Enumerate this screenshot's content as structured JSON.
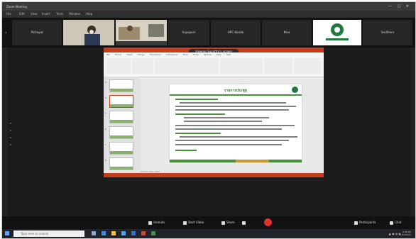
{
  "window": {
    "title": "Zoom Meeting",
    "menu": [
      "File",
      "Edit",
      "View",
      "Insert",
      "Tools",
      "Window",
      "Help"
    ]
  },
  "participants": [
    {
      "name": "Pichayut",
      "type": "name"
    },
    {
      "name": "",
      "type": "video"
    },
    {
      "name": "",
      "type": "video"
    },
    {
      "name": "Supaporn",
      "type": "name"
    },
    {
      "name": "HPC-Kanda",
      "type": "name"
    },
    {
      "name": "Nisa",
      "type": "name"
    },
    {
      "name": "",
      "type": "logo"
    },
    {
      "name": "Sasithorn",
      "type": "name"
    }
  ],
  "share": {
    "view_label": "Viewing Supattra's screen",
    "ppt_tabs": "File Home Insert Design Transitions Animations Slide Show Review View Help",
    "slide_title": "รายการประชุม",
    "slide_numbers": [
      "3",
      "4",
      "5",
      "6",
      "7",
      "8"
    ],
    "notes_placeholder": "Click to add notes"
  },
  "controls": {
    "unmute": "Unmute",
    "start_video": "Start Video",
    "share": "Share",
    "participants": "Participants",
    "chat": "Chat"
  },
  "taskbar": {
    "search_placeholder": "Type here to search",
    "time": "4:46 PM",
    "date": "7/15/2021"
  },
  "colors": {
    "ppt_accent": "#c43e1c",
    "slide_green": "#4a8f3c",
    "end_red": "#e0322e"
  }
}
